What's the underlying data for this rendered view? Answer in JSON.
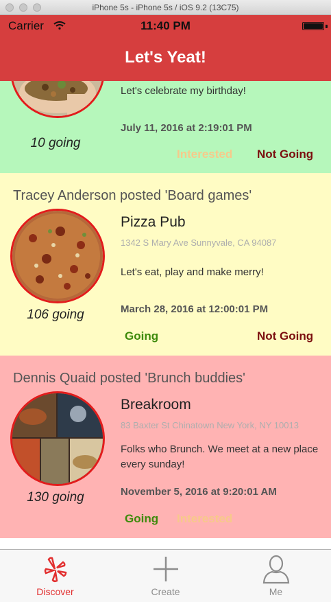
{
  "window": {
    "title": "iPhone 5s - iPhone 5s / iOS 9.2 (13C75)"
  },
  "status_bar": {
    "carrier": "Carrier",
    "time": "11:40 PM",
    "wifi_icon": "wifi-icon",
    "battery_icon": "battery-icon"
  },
  "nav": {
    "title": "Let's Yeat!"
  },
  "events": [
    {
      "background": "#b6f7bb",
      "description": "Let's celebrate my birthday!",
      "datetime": "July 11, 2016 at 2:19:01 PM",
      "going_count": "10 going",
      "actions": [
        "Interested",
        "Not Going"
      ]
    },
    {
      "background": "#fffcc4",
      "poster": "Tracey Anderson posted 'Board games'",
      "venue": "Pizza Pub",
      "address": "1342 S Mary Ave Sunnyvale, CA 94087",
      "description": "Let's eat, play and make merry!",
      "datetime": "March 28, 2016 at 12:00:01 PM",
      "going_count": "106 going",
      "actions": [
        "Going",
        "Not Going"
      ]
    },
    {
      "background": "#ffb3b3",
      "poster": "Dennis Quaid posted 'Brunch buddies'",
      "venue": "Breakroom",
      "address": "83 Baxter St Chinatown New York, NY 10013",
      "description": "Folks who Brunch. We meet at a new place every sunday!",
      "datetime": "November 5, 2016 at 9:20:01 AM",
      "going_count": "130 going",
      "actions": [
        "Going",
        "Interested"
      ]
    }
  ],
  "tabs": [
    {
      "label": "Discover",
      "icon": "yelp-burst-icon",
      "active": true
    },
    {
      "label": "Create",
      "icon": "plus-icon",
      "active": false
    },
    {
      "label": "Me",
      "icon": "person-icon",
      "active": false
    }
  ],
  "colors": {
    "accent": "#d63e3e",
    "going": "#3d8a0a",
    "interested": "#f7c98a",
    "not_going": "#7b0e0e",
    "avatar_border": "#e21c1c"
  }
}
